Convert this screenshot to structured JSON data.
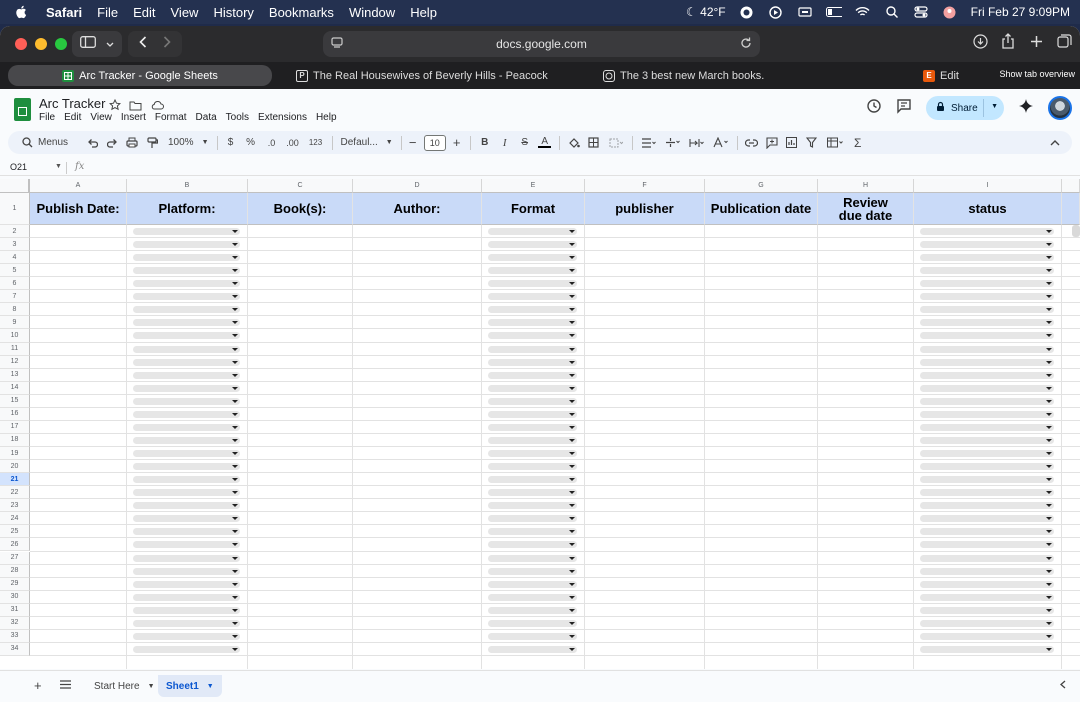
{
  "menubar": {
    "app": "Safari",
    "items": [
      "File",
      "Edit",
      "View",
      "History",
      "Bookmarks",
      "Window",
      "Help"
    ],
    "weather": "42°F",
    "datetime": "Fri Feb 27  9:09PM"
  },
  "browser": {
    "url": "docs.google.com",
    "tabs": [
      {
        "label": "Arc Tracker - Google Sheets",
        "fav": "sheets",
        "color": "#1e8e3e"
      },
      {
        "label": "The Real Housewives of Beverly Hills - Peacock",
        "fav": "P",
        "color": "#1f1f21"
      },
      {
        "label": "The 3 best new March books.",
        "fav": "circle",
        "color": "#1f1f21"
      },
      {
        "label": "Edit",
        "fav": "E",
        "color": "#e8590c"
      }
    ],
    "show_tab_overview": "Show tab overview"
  },
  "sheets": {
    "doc_title": "Arc Tracker",
    "menu": [
      "File",
      "Edit",
      "View",
      "Insert",
      "Format",
      "Data",
      "Tools",
      "Extensions",
      "Help"
    ],
    "share_label": "Share",
    "toolbar": {
      "menus_label": "Menus",
      "zoom": "100%",
      "currency": "$",
      "percent": "%",
      "dec_down": ".0",
      "dec_up": ".00",
      "number_format": "123",
      "font": "Defaul...",
      "font_size": "10"
    },
    "cell_ref": "O21",
    "column_letters": [
      "A",
      "B",
      "C",
      "D",
      "E",
      "F",
      "G",
      "H",
      "I"
    ],
    "headers": [
      "Publish Date:",
      "Platform:",
      "Book(s):",
      "Author:",
      "Format",
      "publisher",
      "Publication date",
      "Review due date",
      "status"
    ],
    "row_numbers": [
      "1",
      "2",
      "3",
      "4",
      "5",
      "6",
      "7",
      "8",
      "9",
      "10",
      "11",
      "12",
      "13",
      "14",
      "15",
      "16",
      "17",
      "18",
      "19",
      "20",
      "21",
      "22",
      "23",
      "24",
      "25",
      "26",
      "27",
      "28",
      "29",
      "30",
      "31",
      "32",
      "33",
      "34"
    ],
    "selected_row": "21",
    "sheet_tabs": [
      "Start Here",
      "Sheet1"
    ],
    "active_sheet": "Sheet1",
    "header_fill": "#c9daf8"
  }
}
